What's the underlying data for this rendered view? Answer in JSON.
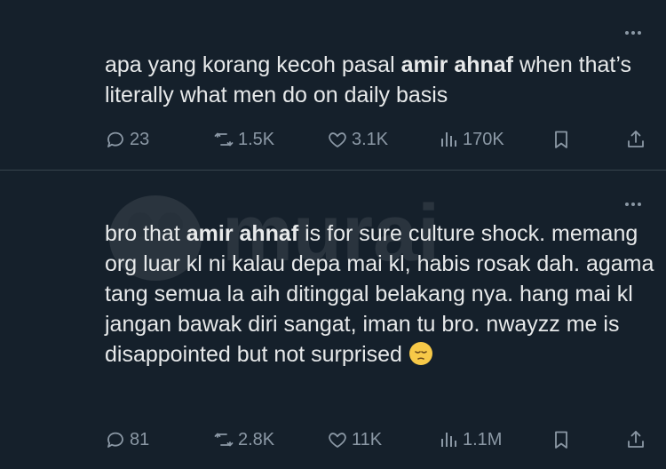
{
  "tweets": [
    {
      "text_before": "apa yang korang kecoh pasal ",
      "text_bold": "amir ahnaf",
      "text_after": " when that’s literally what men do on daily basis",
      "stats": {
        "replies": "23",
        "reposts": "1.5K",
        "likes": "3.1K",
        "views": "170K"
      }
    },
    {
      "text_before": "bro that ",
      "text_bold": "amir ahnaf",
      "text_after": " is for sure culture shock. memang org luar kl ni kalau depa mai kl, habis rosak dah. agama tang semua la aih ditinggal belakang nya. hang mai kl jangan bawak diri sangat, iman tu bro. nwayzz me is disappointed but not surprised",
      "emoji": "pensive-face",
      "stats": {
        "replies": "81",
        "reposts": "2.8K",
        "likes": "11K",
        "views": "1.1M"
      }
    }
  ],
  "icons": {
    "reply": "speech-bubble-icon",
    "repost": "repost-arrows-icon",
    "like": "heart-icon",
    "views": "bar-chart-icon",
    "bookmark": "bookmark-icon",
    "share": "share-icon",
    "more": "more-dots-icon"
  },
  "watermark": {
    "brand": "murai"
  },
  "colors": {
    "background": "#15202b",
    "text": "#e7e9ea",
    "muted": "#8b98a5",
    "divider": "#38444d"
  }
}
